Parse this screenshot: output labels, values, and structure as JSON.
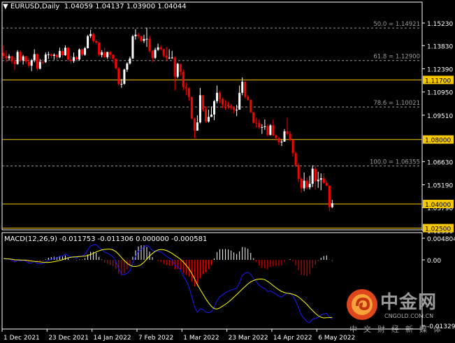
{
  "header": {
    "symbol": "EURUSD,Daily",
    "ohlc": "1.04059 1.04137 1.03900 1.04044"
  },
  "macd_header": "MACD(12,26,9) -0.011753 -0.011306 0.000000 -0.000581",
  "colors": {
    "bull": "#ffffff",
    "bear": "#ff0000",
    "level": "#f5c800",
    "fib": "#9a9a9a",
    "macd_main": "#1a1aff",
    "macd_signal": "#ffff00"
  },
  "price_axis": {
    "ticks": [
      "1.15230",
      "1.13830",
      "1.12390",
      "1.10950",
      "1.09510",
      "1.06630",
      "1.05190",
      "1.03790",
      "1.02350"
    ]
  },
  "macd_axis": {
    "ticks": [
      "0.004804",
      "0.00",
      "-0.013299"
    ]
  },
  "date_axis": {
    "labels": [
      "1 Dec 2021",
      "23 Dec 2021",
      "14 Jan 2022",
      "7 Feb 2022",
      "1 Mar 2022",
      "23 Mar 2022",
      "14 Apr 2022",
      "6 May 2022"
    ]
  },
  "fib_levels": [
    {
      "label": "50.0 = 1.14921",
      "price": 1.14921
    },
    {
      "label": "61.8 = 1.12900",
      "price": 1.129
    },
    {
      "label": "78.6 = 1.10021",
      "price": 1.10021
    },
    {
      "label": "100.0 = 1.06355",
      "price": 1.06355
    }
  ],
  "horizontal_levels": [
    {
      "label": "1.11700",
      "price": 1.117
    },
    {
      "label": "1.08000",
      "price": 1.08
    },
    {
      "label": "1.04000",
      "price": 1.04
    },
    {
      "label": "1.02500",
      "price": 1.025
    }
  ],
  "watermark": {
    "title": "中金网",
    "url": "CNGOLD.COM.CN",
    "subtitle": "中文财经新媒体"
  },
  "chart_data": {
    "type": "candlestick",
    "first_open": 1.1338,
    "close": [
      1.1319,
      1.1305,
      1.1317,
      1.1286,
      1.1268,
      1.1344,
      1.129,
      1.1316,
      1.1284,
      1.1258,
      1.1292,
      1.133,
      1.124,
      1.1282,
      1.1281,
      1.1328,
      1.1329,
      1.1319,
      1.1326,
      1.131,
      1.135,
      1.1323,
      1.137,
      1.1296,
      1.1287,
      1.1312,
      1.1297,
      1.1359,
      1.1326,
      1.1367,
      1.1442,
      1.1455,
      1.1411,
      1.1402,
      1.1325,
      1.1342,
      1.1311,
      1.1343,
      1.1326,
      1.1301,
      1.1242,
      1.1144,
      1.1146,
      1.1234,
      1.1272,
      1.1303,
      1.1441,
      1.1451,
      1.1442,
      1.1413,
      1.1424,
      1.1425,
      1.135,
      1.1307,
      1.1357,
      1.1372,
      1.1361,
      1.1321,
      1.1308,
      1.1308,
      1.1309,
      1.119,
      1.127,
      1.1219,
      1.1125,
      1.1118,
      1.1064,
      1.093,
      1.0855,
      1.0906,
      1.1075,
      1.0986,
      1.0912,
      1.094,
      1.0955,
      1.1038,
      1.109,
      1.105,
      1.1017,
      1.1016,
      1.1006,
      1.0998,
      1.0983,
      1.0985,
      1.109,
      1.1159,
      1.1066,
      1.1046,
      1.097,
      1.0904,
      1.0902,
      1.0876,
      1.0877,
      1.0882,
      1.0828,
      1.0888,
      1.0826,
      1.0809,
      1.0782,
      1.0787,
      1.0851,
      1.0836,
      1.0797,
      1.0715,
      1.064,
      1.0557,
      1.0497,
      1.0544,
      1.0503,
      1.0525,
      1.0619,
      1.0541,
      1.055,
      1.056,
      1.053,
      1.0513,
      1.038,
      1.0404
    ],
    "high": [
      1.1383,
      1.1353,
      1.133,
      1.132,
      1.131,
      1.1355,
      1.1355,
      1.1325,
      1.132,
      1.1305,
      1.13,
      1.136,
      1.1335,
      1.13,
      1.13,
      1.134,
      1.1345,
      1.1335,
      1.1335,
      1.133,
      1.137,
      1.1365,
      1.1385,
      1.1375,
      1.132,
      1.134,
      1.132,
      1.1365,
      1.1365,
      1.1375,
      1.145,
      1.1482,
      1.1465,
      1.142,
      1.1405,
      1.1355,
      1.137,
      1.1345,
      1.135,
      1.133,
      1.1305,
      1.125,
      1.1175,
      1.124,
      1.128,
      1.1315,
      1.145,
      1.1485,
      1.1465,
      1.1445,
      1.145,
      1.1495,
      1.1445,
      1.1355,
      1.137,
      1.1395,
      1.1385,
      1.1365,
      1.1375,
      1.136,
      1.135,
      1.1315,
      1.1275,
      1.1255,
      1.1235,
      1.1155,
      1.1125,
      1.1065,
      1.0935,
      1.095,
      1.112,
      1.1075,
      1.1005,
      1.0985,
      1.1005,
      1.1045,
      1.1135,
      1.11,
      1.106,
      1.1045,
      1.1035,
      1.102,
      1.1005,
      1.1015,
      1.1135,
      1.1185,
      1.116,
      1.1075,
      1.1045,
      1.097,
      1.0935,
      1.0925,
      1.0895,
      1.0925,
      1.0895,
      1.0895,
      1.0925,
      1.083,
      1.0815,
      1.08,
      1.0865,
      1.0935,
      1.085,
      1.08,
      1.0725,
      1.0655,
      1.0565,
      1.0595,
      1.0565,
      1.0575,
      1.064,
      1.064,
      1.06,
      1.059,
      1.059,
      1.0545,
      1.0515,
      1.0425
    ],
    "low": [
      1.13,
      1.128,
      1.129,
      1.127,
      1.123,
      1.1265,
      1.128,
      1.1265,
      1.127,
      1.1245,
      1.1225,
      1.128,
      1.1225,
      1.1235,
      1.1265,
      1.1275,
      1.13,
      1.1305,
      1.1295,
      1.129,
      1.1305,
      1.1305,
      1.132,
      1.1285,
      1.127,
      1.1275,
      1.1285,
      1.129,
      1.1315,
      1.132,
      1.1365,
      1.143,
      1.14,
      1.139,
      1.1315,
      1.131,
      1.1305,
      1.13,
      1.13,
      1.1275,
      1.1235,
      1.1135,
      1.1121,
      1.114,
      1.122,
      1.1265,
      1.13,
      1.142,
      1.1425,
      1.1405,
      1.14,
      1.1375,
      1.134,
      1.128,
      1.13,
      1.135,
      1.1355,
      1.131,
      1.129,
      1.13,
      1.13,
      1.1106,
      1.118,
      1.1195,
      1.1105,
      1.1075,
      1.104,
      1.0925,
      1.0806,
      1.0875,
      1.09,
      1.0975,
      1.0905,
      1.0905,
      1.094,
      1.092,
      1.1025,
      1.1025,
      1.0995,
      1.0985,
      1.099,
      1.0985,
      1.0965,
      1.0945,
      1.0985,
      1.1075,
      1.1055,
      1.104,
      1.0965,
      1.09,
      1.0875,
      1.0865,
      1.0835,
      1.086,
      1.082,
      1.0825,
      1.082,
      1.0795,
      1.0765,
      1.076,
      1.0785,
      1.0825,
      1.079,
      1.0695,
      1.063,
      1.0535,
      1.047,
      1.048,
      1.049,
      1.049,
      1.0505,
      1.049,
      1.05,
      1.0485,
      1.0525,
      1.051,
      1.0355,
      1.0375
    ],
    "price_range": [
      1.0235,
      1.1523
    ],
    "macd_range": [
      -0.013299,
      0.004804
    ],
    "macd_params": [
      12,
      26,
      9
    ],
    "grid": false
  }
}
